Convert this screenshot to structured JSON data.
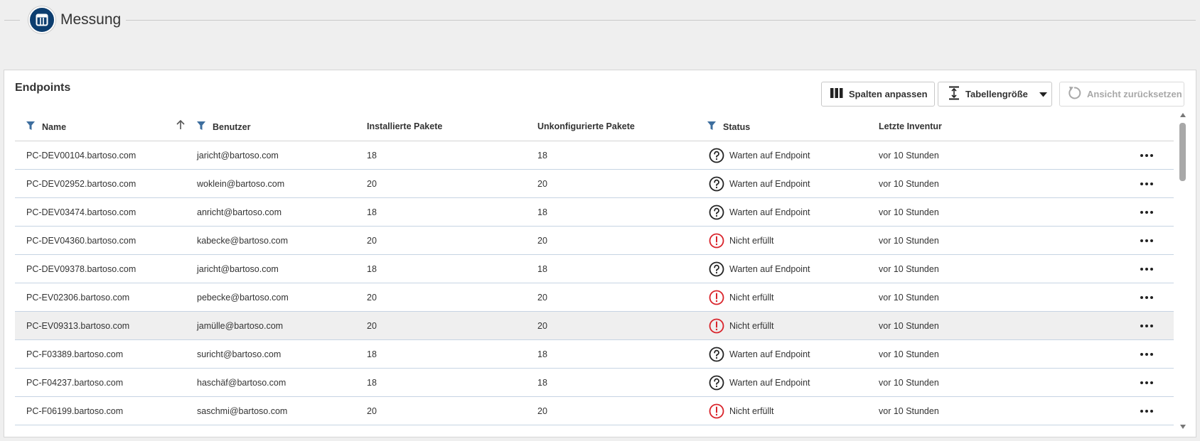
{
  "header": {
    "title": "Messung",
    "app_icon": "calculator-icon"
  },
  "panel": {
    "title": "Endpoints",
    "buttons": {
      "columns": "Spalten anpassen",
      "size": "Tabellengröße",
      "reset": "Ansicht zurücksetzen"
    }
  },
  "table": {
    "columns": {
      "name": "Name",
      "user": "Benutzer",
      "installed": "Installierte Pakete",
      "unconfigured": "Unkonfigurierte Pakete",
      "status": "Status",
      "inventory": "Letzte Inventur"
    },
    "sort": {
      "column": "Name",
      "direction": "ascending"
    },
    "rows": [
      {
        "name": "PC-DEV00104.bartoso.com",
        "user": "jaricht@bartoso.com",
        "installed": "18",
        "unconfigured": "18",
        "status": "Warten auf Endpoint",
        "status_type": "waiting",
        "inventory": "vor 10 Stunden"
      },
      {
        "name": "PC-DEV02952.bartoso.com",
        "user": "woklein@bartoso.com",
        "installed": "20",
        "unconfigured": "20",
        "status": "Warten auf Endpoint",
        "status_type": "waiting",
        "inventory": "vor 10 Stunden"
      },
      {
        "name": "PC-DEV03474.bartoso.com",
        "user": "anricht@bartoso.com",
        "installed": "18",
        "unconfigured": "18",
        "status": "Warten auf Endpoint",
        "status_type": "waiting",
        "inventory": "vor 10 Stunden"
      },
      {
        "name": "PC-DEV04360.bartoso.com",
        "user": "kabecke@bartoso.com",
        "installed": "20",
        "unconfigured": "20",
        "status": "Nicht erfüllt",
        "status_type": "error",
        "inventory": "vor 10 Stunden"
      },
      {
        "name": "PC-DEV09378.bartoso.com",
        "user": "jaricht@bartoso.com",
        "installed": "18",
        "unconfigured": "18",
        "status": "Warten auf Endpoint",
        "status_type": "waiting",
        "inventory": "vor 10 Stunden"
      },
      {
        "name": "PC-EV02306.bartoso.com",
        "user": "pebecke@bartoso.com",
        "installed": "20",
        "unconfigured": "20",
        "status": "Nicht erfüllt",
        "status_type": "error",
        "inventory": "vor 10 Stunden"
      },
      {
        "name": "PC-EV09313.bartoso.com",
        "user": "jamülle@bartoso.com",
        "installed": "20",
        "unconfigured": "20",
        "status": "Nicht erfüllt",
        "status_type": "error",
        "inventory": "vor 10 Stunden",
        "highlighted": true
      },
      {
        "name": "PC-F03389.bartoso.com",
        "user": "suricht@bartoso.com",
        "installed": "18",
        "unconfigured": "18",
        "status": "Warten auf Endpoint",
        "status_type": "waiting",
        "inventory": "vor 10 Stunden"
      },
      {
        "name": "PC-F04237.bartoso.com",
        "user": "haschäf@bartoso.com",
        "installed": "18",
        "unconfigured": "18",
        "status": "Warten auf Endpoint",
        "status_type": "waiting",
        "inventory": "vor 10 Stunden"
      },
      {
        "name": "PC-F06199.bartoso.com",
        "user": "saschmi@bartoso.com",
        "installed": "20",
        "unconfigured": "20",
        "status": "Nicht erfüllt",
        "status_type": "error",
        "inventory": "vor 10 Stunden"
      }
    ]
  },
  "colors": {
    "accent": "#0d3e6f",
    "filter_icon": "#3d6e9e",
    "error": "#d9232a",
    "row_border": "#c6d4e3"
  }
}
